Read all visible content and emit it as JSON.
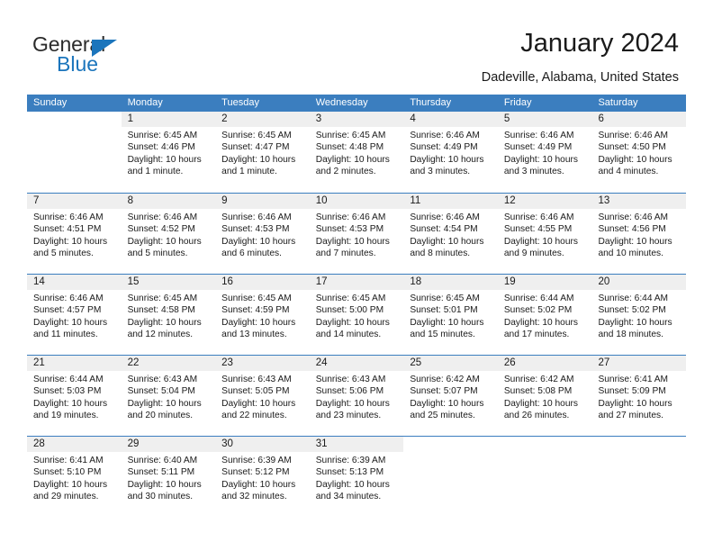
{
  "brand": {
    "name_part1": "General",
    "name_part2": "Blue",
    "triangle_color": "#1b75bc"
  },
  "header": {
    "title": "January 2024",
    "subtitle": "Dadeville, Alabama, United States",
    "header_bg_color": "#3b7ebf"
  },
  "weekdays": [
    "Sunday",
    "Monday",
    "Tuesday",
    "Wednesday",
    "Thursday",
    "Friday",
    "Saturday"
  ],
  "weeks": [
    [
      {
        "day": "",
        "sunrise": "",
        "sunset": "",
        "daylight": ""
      },
      {
        "day": "1",
        "sunrise": "Sunrise: 6:45 AM",
        "sunset": "Sunset: 4:46 PM",
        "daylight": "Daylight: 10 hours and 1 minute."
      },
      {
        "day": "2",
        "sunrise": "Sunrise: 6:45 AM",
        "sunset": "Sunset: 4:47 PM",
        "daylight": "Daylight: 10 hours and 1 minute."
      },
      {
        "day": "3",
        "sunrise": "Sunrise: 6:45 AM",
        "sunset": "Sunset: 4:48 PM",
        "daylight": "Daylight: 10 hours and 2 minutes."
      },
      {
        "day": "4",
        "sunrise": "Sunrise: 6:46 AM",
        "sunset": "Sunset: 4:49 PM",
        "daylight": "Daylight: 10 hours and 3 minutes."
      },
      {
        "day": "5",
        "sunrise": "Sunrise: 6:46 AM",
        "sunset": "Sunset: 4:49 PM",
        "daylight": "Daylight: 10 hours and 3 minutes."
      },
      {
        "day": "6",
        "sunrise": "Sunrise: 6:46 AM",
        "sunset": "Sunset: 4:50 PM",
        "daylight": "Daylight: 10 hours and 4 minutes."
      }
    ],
    [
      {
        "day": "7",
        "sunrise": "Sunrise: 6:46 AM",
        "sunset": "Sunset: 4:51 PM",
        "daylight": "Daylight: 10 hours and 5 minutes."
      },
      {
        "day": "8",
        "sunrise": "Sunrise: 6:46 AM",
        "sunset": "Sunset: 4:52 PM",
        "daylight": "Daylight: 10 hours and 5 minutes."
      },
      {
        "day": "9",
        "sunrise": "Sunrise: 6:46 AM",
        "sunset": "Sunset: 4:53 PM",
        "daylight": "Daylight: 10 hours and 6 minutes."
      },
      {
        "day": "10",
        "sunrise": "Sunrise: 6:46 AM",
        "sunset": "Sunset: 4:53 PM",
        "daylight": "Daylight: 10 hours and 7 minutes."
      },
      {
        "day": "11",
        "sunrise": "Sunrise: 6:46 AM",
        "sunset": "Sunset: 4:54 PM",
        "daylight": "Daylight: 10 hours and 8 minutes."
      },
      {
        "day": "12",
        "sunrise": "Sunrise: 6:46 AM",
        "sunset": "Sunset: 4:55 PM",
        "daylight": "Daylight: 10 hours and 9 minutes."
      },
      {
        "day": "13",
        "sunrise": "Sunrise: 6:46 AM",
        "sunset": "Sunset: 4:56 PM",
        "daylight": "Daylight: 10 hours and 10 minutes."
      }
    ],
    [
      {
        "day": "14",
        "sunrise": "Sunrise: 6:46 AM",
        "sunset": "Sunset: 4:57 PM",
        "daylight": "Daylight: 10 hours and 11 minutes."
      },
      {
        "day": "15",
        "sunrise": "Sunrise: 6:45 AM",
        "sunset": "Sunset: 4:58 PM",
        "daylight": "Daylight: 10 hours and 12 minutes."
      },
      {
        "day": "16",
        "sunrise": "Sunrise: 6:45 AM",
        "sunset": "Sunset: 4:59 PM",
        "daylight": "Daylight: 10 hours and 13 minutes."
      },
      {
        "day": "17",
        "sunrise": "Sunrise: 6:45 AM",
        "sunset": "Sunset: 5:00 PM",
        "daylight": "Daylight: 10 hours and 14 minutes."
      },
      {
        "day": "18",
        "sunrise": "Sunrise: 6:45 AM",
        "sunset": "Sunset: 5:01 PM",
        "daylight": "Daylight: 10 hours and 15 minutes."
      },
      {
        "day": "19",
        "sunrise": "Sunrise: 6:44 AM",
        "sunset": "Sunset: 5:02 PM",
        "daylight": "Daylight: 10 hours and 17 minutes."
      },
      {
        "day": "20",
        "sunrise": "Sunrise: 6:44 AM",
        "sunset": "Sunset: 5:02 PM",
        "daylight": "Daylight: 10 hours and 18 minutes."
      }
    ],
    [
      {
        "day": "21",
        "sunrise": "Sunrise: 6:44 AM",
        "sunset": "Sunset: 5:03 PM",
        "daylight": "Daylight: 10 hours and 19 minutes."
      },
      {
        "day": "22",
        "sunrise": "Sunrise: 6:43 AM",
        "sunset": "Sunset: 5:04 PM",
        "daylight": "Daylight: 10 hours and 20 minutes."
      },
      {
        "day": "23",
        "sunrise": "Sunrise: 6:43 AM",
        "sunset": "Sunset: 5:05 PM",
        "daylight": "Daylight: 10 hours and 22 minutes."
      },
      {
        "day": "24",
        "sunrise": "Sunrise: 6:43 AM",
        "sunset": "Sunset: 5:06 PM",
        "daylight": "Daylight: 10 hours and 23 minutes."
      },
      {
        "day": "25",
        "sunrise": "Sunrise: 6:42 AM",
        "sunset": "Sunset: 5:07 PM",
        "daylight": "Daylight: 10 hours and 25 minutes."
      },
      {
        "day": "26",
        "sunrise": "Sunrise: 6:42 AM",
        "sunset": "Sunset: 5:08 PM",
        "daylight": "Daylight: 10 hours and 26 minutes."
      },
      {
        "day": "27",
        "sunrise": "Sunrise: 6:41 AM",
        "sunset": "Sunset: 5:09 PM",
        "daylight": "Daylight: 10 hours and 27 minutes."
      }
    ],
    [
      {
        "day": "28",
        "sunrise": "Sunrise: 6:41 AM",
        "sunset": "Sunset: 5:10 PM",
        "daylight": "Daylight: 10 hours and 29 minutes."
      },
      {
        "day": "29",
        "sunrise": "Sunrise: 6:40 AM",
        "sunset": "Sunset: 5:11 PM",
        "daylight": "Daylight: 10 hours and 30 minutes."
      },
      {
        "day": "30",
        "sunrise": "Sunrise: 6:39 AM",
        "sunset": "Sunset: 5:12 PM",
        "daylight": "Daylight: 10 hours and 32 minutes."
      },
      {
        "day": "31",
        "sunrise": "Sunrise: 6:39 AM",
        "sunset": "Sunset: 5:13 PM",
        "daylight": "Daylight: 10 hours and 34 minutes."
      },
      {
        "day": "",
        "sunrise": "",
        "sunset": "",
        "daylight": ""
      },
      {
        "day": "",
        "sunrise": "",
        "sunset": "",
        "daylight": ""
      },
      {
        "day": "",
        "sunrise": "",
        "sunset": "",
        "daylight": ""
      }
    ]
  ]
}
